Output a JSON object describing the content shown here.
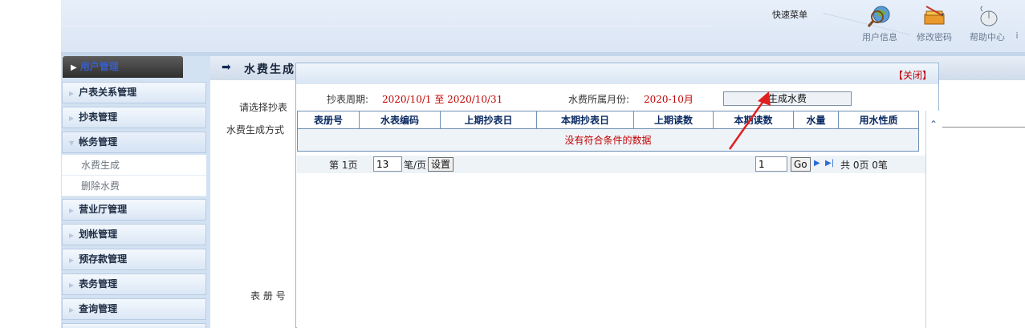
{
  "header": {
    "quick_menu_label": "快速菜单",
    "tools": [
      {
        "label": "用户信息",
        "icon": "user-info-icon"
      },
      {
        "label": "修改密码",
        "icon": "change-password-icon"
      },
      {
        "label": "帮助中心",
        "icon": "help-center-icon"
      },
      {
        "label": "i",
        "icon": "exit-icon"
      }
    ]
  },
  "sidebar": {
    "header": "用户管理",
    "items": [
      {
        "label": "户表关系管理"
      },
      {
        "label": "抄表管理"
      },
      {
        "label": "帐务管理",
        "expanded": true,
        "children": [
          {
            "label": "水费生成"
          },
          {
            "label": "删除水费"
          }
        ]
      },
      {
        "label": "营业厅管理"
      },
      {
        "label": "划帐管理"
      },
      {
        "label": "预存款管理"
      },
      {
        "label": "表务管理"
      },
      {
        "label": "查询管理"
      }
    ]
  },
  "content": {
    "title": "水费生成",
    "select_label": "请选择抄表",
    "mode_label": "水费生成方式",
    "account_no_label": "表 册 号"
  },
  "modal": {
    "close_label": "【关闭】",
    "period_label": "抄表周期:",
    "period_value": "2020/10/1 至 2020/10/31",
    "month_label": "水费所属月份:",
    "month_value": "2020-10月",
    "generate_button": "生成水费",
    "table": {
      "columns": [
        "表册号",
        "水表编码",
        "上期抄表日",
        "本期抄表日",
        "上期读数",
        "本期读数",
        "水量",
        "用水性质"
      ],
      "empty_message": "没有符合条件的数据"
    },
    "pager": {
      "page_text": "第 1页",
      "page_size": "13",
      "page_size_suffix": "笔/页",
      "set_button": "设置",
      "goto_page": "1",
      "go_button": "Go",
      "summary": "共 0页 0笔"
    }
  },
  "colors": {
    "accent_red": "#c00000",
    "header_blue": "#0b2b63",
    "sidebar_bg": "#d3e2f2"
  }
}
